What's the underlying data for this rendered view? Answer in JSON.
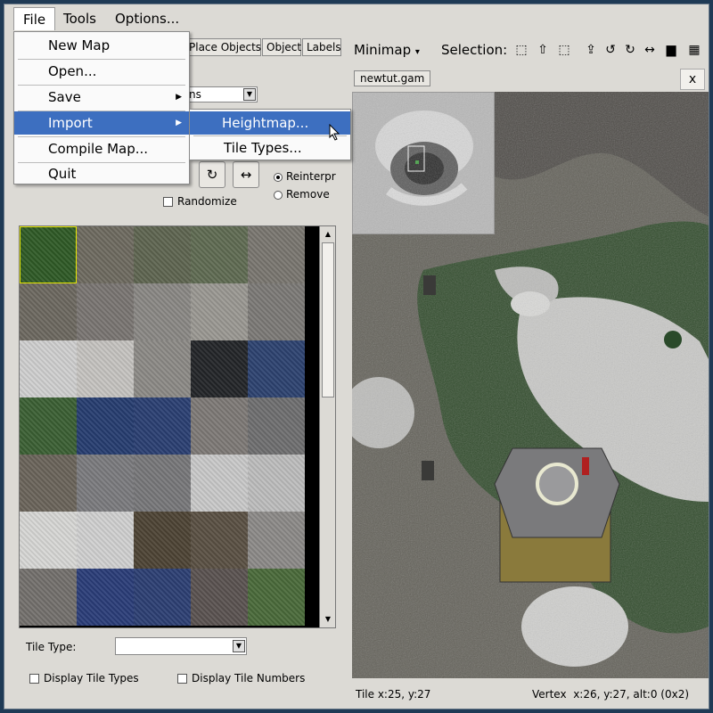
{
  "menubar": {
    "file": "File",
    "tools": "Tools",
    "options": "Options..."
  },
  "file_menu": {
    "new_map": "New Map",
    "open": "Open...",
    "save": "Save",
    "import": "Import",
    "compile": "Compile Map...",
    "quit": "Quit"
  },
  "import_menu": {
    "heightmap": "Heightmap...",
    "tile_types": "Tile Types..."
  },
  "left": {
    "tabs": [
      "Place Objects",
      "Object",
      "Labels"
    ],
    "combo_value": "ns",
    "randomize": "Randomize",
    "reinterpret": "Reinterpr",
    "remove": "Remove ",
    "tile_type_label": "Tile Type:",
    "tile_type_value": "",
    "display_tile_types": "Display Tile Types",
    "display_tile_numbers": "Display Tile Numbers"
  },
  "right": {
    "minimap": "Minimap",
    "minimap_arrow": "▾",
    "selection": "Selection:",
    "file_tab": "newtut.gam",
    "close": "x",
    "status_tile": "Tile x:25, y:27",
    "status_vertex": "Vertex  x:26, y:27, alt:0 (0x2)"
  },
  "icons": {
    "rotate_cw": "↻",
    "flip": "↔",
    "undo": "↺",
    "redo": "↻",
    "select_rect": "⬚",
    "grid": "▦"
  },
  "colors": {
    "highlight": "#3d6fc0",
    "panel": "#dcdad5",
    "selected_tile_border": "#e8e800"
  },
  "tiles": [
    "#2f5a26",
    "#6e6a60",
    "#5e6550",
    "#5f6b52",
    "#7a7670",
    "#6c6860",
    "#7a7572",
    "#8a8884",
    "#9a9892",
    "#7c7a76",
    "#cfcfcf",
    "#c5c3c0",
    "#8c8a86",
    "#232528",
    "#2d4270",
    "#3b5f33",
    "#263d70",
    "#2a3f72",
    "#7e7a76",
    "#6f6f70",
    "#6a645a",
    "#7b7b7e",
    "#77777a",
    "#c9c9c9",
    "#bdbdbd",
    "#d7d7d5",
    "#d0d0d0",
    "#4d4334",
    "#5a5043",
    "#8c8a88",
    "#73706c",
    "#2a3d78",
    "#2c3f73",
    "#5a5250",
    "#4a6a3a"
  ]
}
